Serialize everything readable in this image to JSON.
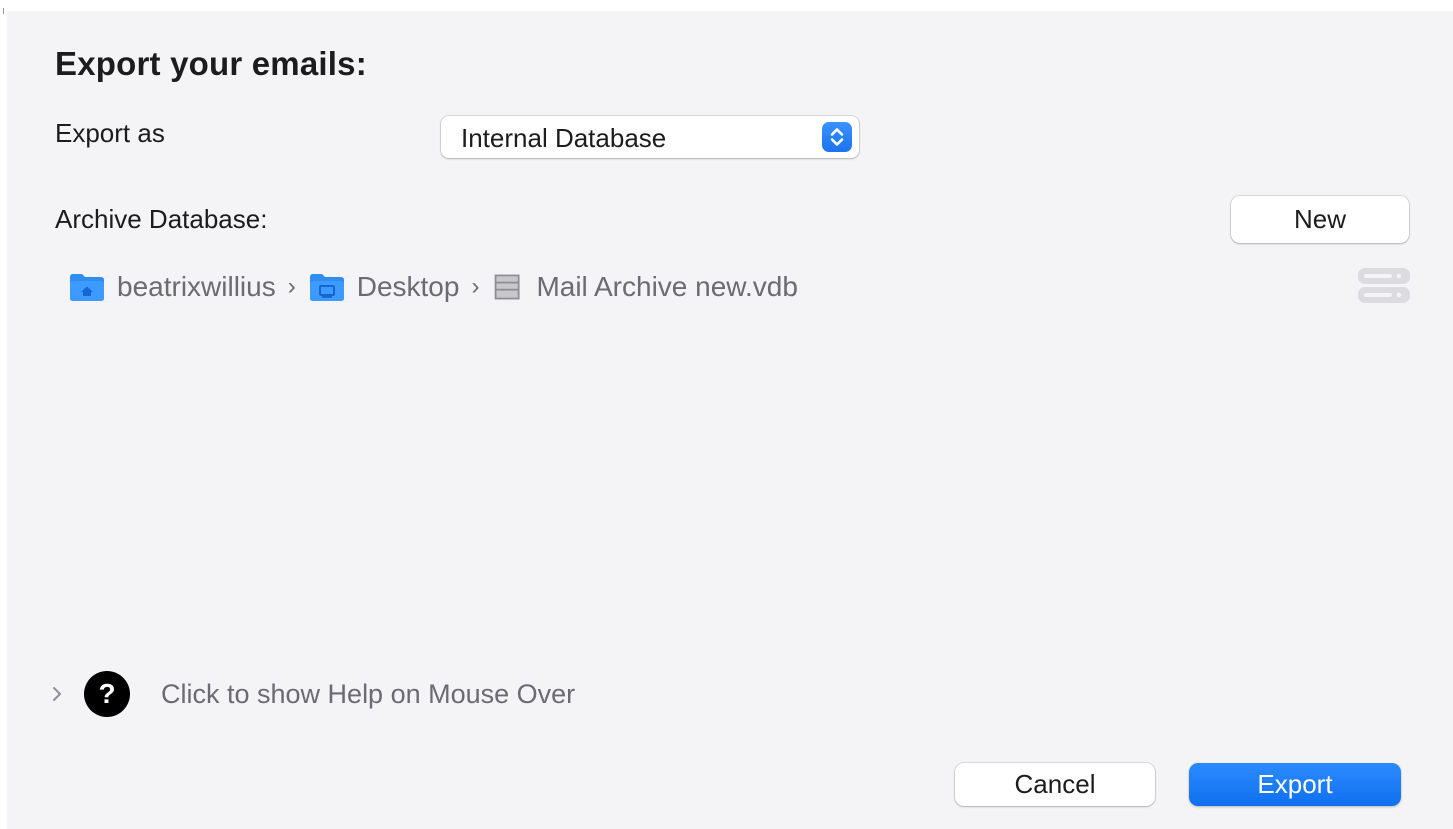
{
  "dialog": {
    "title": "Export your emails:",
    "export_as_label": "Export as",
    "export_as_value": "Internal Database",
    "archive_label": "Archive Database:",
    "new_button": "New"
  },
  "path": [
    {
      "name": "beatrixwillius",
      "icon": "home-folder-icon"
    },
    {
      "name": "Desktop",
      "icon": "desktop-folder-icon"
    },
    {
      "name": "Mail Archive new.vdb",
      "icon": "database-file-icon"
    }
  ],
  "help": {
    "text": "Click to show Help on Mouse Over"
  },
  "footer": {
    "cancel": "Cancel",
    "export": "Export"
  },
  "colors": {
    "accent": "#1a7cf5",
    "background": "#f4f4f6",
    "folder_blue": "#2f8cf4"
  }
}
